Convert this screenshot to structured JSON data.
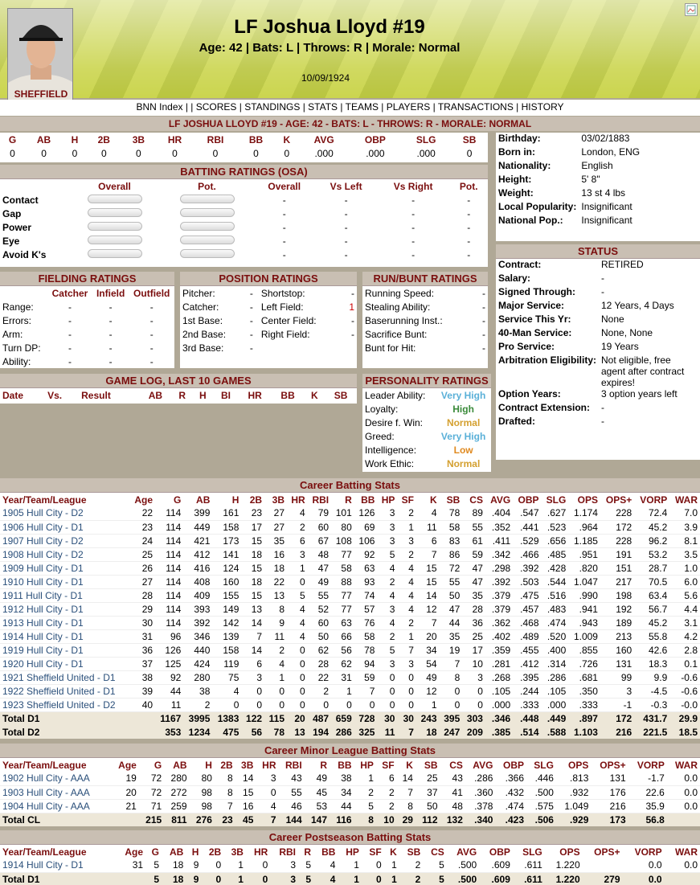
{
  "player": {
    "name": "LF Joshua Lloyd #19",
    "subtitle": "Age: 42 | Bats: L | Throws: R | Morale: Normal",
    "date": "10/09/1924",
    "banner": "LF JOSHUA LLOYD #19 - AGE: 42 - BATS: L - THROWS: R - MORALE: NORMAL",
    "jersey": "SHEFFIELD"
  },
  "nav": [
    "BNN Index",
    " | ",
    "| SCORES",
    " | ",
    "STANDINGS",
    " | ",
    "STATS",
    " | ",
    "TEAMS",
    " | ",
    "PLAYERS",
    " | ",
    "TRANSACTIONS",
    " | ",
    "HISTORY"
  ],
  "summary": {
    "headers": [
      "G",
      "AB",
      "H",
      "2B",
      "3B",
      "HR",
      "RBI",
      "BB",
      "K",
      "AVG",
      "OBP",
      "SLG",
      "SB"
    ],
    "values": [
      "0",
      "0",
      "0",
      "0",
      "0",
      "0",
      "0",
      "0",
      "0",
      ".000",
      ".000",
      ".000",
      "0"
    ]
  },
  "bio": [
    [
      "Birthday:",
      "03/02/1883"
    ],
    [
      "Born in:",
      "London, ENG"
    ],
    [
      "Nationality:",
      "English"
    ],
    [
      "Height:",
      "5' 8\""
    ],
    [
      "Weight:",
      "13 st 4 lbs"
    ],
    [
      "Local Popularity:",
      "Insignificant"
    ],
    [
      "National Pop.:",
      "Insignificant"
    ]
  ],
  "batting_ratings": {
    "title": "BATTING RATINGS (OSA)",
    "headers": [
      "Overall",
      "Pot.",
      "Overall",
      "Vs Left",
      "Vs Right",
      "Pot."
    ],
    "rows": [
      [
        "Contact",
        "-",
        "-",
        "-",
        "-"
      ],
      [
        "Gap",
        "-",
        "-",
        "-",
        "-"
      ],
      [
        "Power",
        "-",
        "-",
        "-",
        "-"
      ],
      [
        "Eye",
        "-",
        "-",
        "-",
        "-"
      ],
      [
        "Avoid K's",
        "-",
        "-",
        "-",
        "-"
      ]
    ]
  },
  "status": {
    "title": "STATUS",
    "rows": [
      [
        "Contract:",
        "RETIRED"
      ],
      [
        "Salary:",
        "-"
      ],
      [
        "Signed Through:",
        "-"
      ],
      [
        "Major Service:",
        "12 Years, 4 Days"
      ],
      [
        "Service This Yr:",
        "None"
      ],
      [
        "40-Man Service:",
        "None, None"
      ],
      [
        "Pro Service:",
        "19 Years"
      ],
      [
        "Arbitration Eligibility:",
        "Not eligible, free agent after contract expires!"
      ],
      [
        "Option Years:",
        "3 option years left"
      ],
      [
        "Contract Extension:",
        "-"
      ],
      [
        "Drafted:",
        "-"
      ]
    ]
  },
  "fielding": {
    "title": "FIELDING RATINGS",
    "headers": [
      "Catcher",
      "Infield",
      "Outfield"
    ],
    "rows": [
      [
        "Range:",
        "-",
        "-",
        "-"
      ],
      [
        "Errors:",
        "-",
        "-",
        "-"
      ],
      [
        "Arm:",
        "-",
        "-",
        "-"
      ],
      [
        "Turn DP:",
        "-",
        "-",
        "-"
      ],
      [
        "Ability:",
        "-",
        "-",
        "-"
      ]
    ]
  },
  "position": {
    "title": "POSITION RATINGS",
    "rows": [
      [
        "Pitcher:",
        "-",
        "Shortstop:",
        "-"
      ],
      [
        "Catcher:",
        "-",
        "Left Field:",
        "1"
      ],
      [
        "1st Base:",
        "-",
        "Center Field:",
        "-"
      ],
      [
        "2nd Base:",
        "-",
        "Right Field:",
        "-"
      ],
      [
        "3rd Base:",
        "-",
        "",
        ""
      ]
    ]
  },
  "runbunt": {
    "title": "RUN/BUNT RATINGS",
    "rows": [
      [
        "Running Speed:",
        "-"
      ],
      [
        "Stealing Ability:",
        "-"
      ],
      [
        "Baserunning Inst.:",
        "-"
      ],
      [
        "Sacrifice Bunt:",
        "-"
      ],
      [
        "Bunt for Hit:",
        "-"
      ]
    ]
  },
  "gamelog": {
    "title": "GAME LOG, LAST 10 GAMES",
    "headers": [
      "Date",
      "Vs.",
      "Result",
      "AB",
      "R",
      "H",
      "BI",
      "HR",
      "BB",
      "K",
      "SB"
    ]
  },
  "personality": {
    "title": "PERSONALITY RATINGS",
    "rows": [
      [
        "Leader Ability:",
        "Very High",
        "vh"
      ],
      [
        "Loyalty:",
        "High",
        "hi"
      ],
      [
        "Desire f. Win:",
        "Normal",
        "no"
      ],
      [
        "Greed:",
        "Very High",
        "vh"
      ],
      [
        "Intelligence:",
        "Low",
        "lo"
      ],
      [
        "Work Ethic:",
        "Normal",
        "no"
      ]
    ]
  },
  "career": {
    "title": "Career Batting Stats",
    "headers": [
      "Year/Team/League",
      "Age",
      "G",
      "AB",
      "H",
      "2B",
      "3B",
      "HR",
      "RBI",
      "R",
      "BB",
      "HP",
      "SF",
      "K",
      "SB",
      "CS",
      "AVG",
      "OBP",
      "SLG",
      "OPS",
      "OPS+",
      "VORP",
      "WAR"
    ],
    "rows": [
      [
        "1905 Hull City - D2",
        "22",
        "114",
        "399",
        "161",
        "23",
        "27",
        "4",
        "79",
        "101",
        "126",
        "3",
        "2",
        "4",
        "78",
        "89",
        ".404",
        ".547",
        ".627",
        "1.174",
        "228",
        "72.4",
        "7.0"
      ],
      [
        "1906 Hull City - D1",
        "23",
        "114",
        "449",
        "158",
        "17",
        "27",
        "2",
        "60",
        "80",
        "69",
        "3",
        "1",
        "11",
        "58",
        "55",
        ".352",
        ".441",
        ".523",
        ".964",
        "172",
        "45.2",
        "3.9"
      ],
      [
        "1907 Hull City - D2",
        "24",
        "114",
        "421",
        "173",
        "15",
        "35",
        "6",
        "67",
        "108",
        "106",
        "3",
        "3",
        "6",
        "83",
        "61",
        ".411",
        ".529",
        ".656",
        "1.185",
        "228",
        "96.2",
        "8.1"
      ],
      [
        "1908 Hull City - D2",
        "25",
        "114",
        "412",
        "141",
        "18",
        "16",
        "3",
        "48",
        "77",
        "92",
        "5",
        "2",
        "7",
        "86",
        "59",
        ".342",
        ".466",
        ".485",
        ".951",
        "191",
        "53.2",
        "3.5"
      ],
      [
        "1909 Hull City - D1",
        "26",
        "114",
        "416",
        "124",
        "15",
        "18",
        "1",
        "47",
        "58",
        "63",
        "4",
        "4",
        "15",
        "72",
        "47",
        ".298",
        ".392",
        ".428",
        ".820",
        "151",
        "28.7",
        "1.0"
      ],
      [
        "1910 Hull City - D1",
        "27",
        "114",
        "408",
        "160",
        "18",
        "22",
        "0",
        "49",
        "88",
        "93",
        "2",
        "4",
        "15",
        "55",
        "47",
        ".392",
        ".503",
        ".544",
        "1.047",
        "217",
        "70.5",
        "6.0"
      ],
      [
        "1911 Hull City - D1",
        "28",
        "114",
        "409",
        "155",
        "15",
        "13",
        "5",
        "55",
        "77",
        "74",
        "4",
        "4",
        "14",
        "50",
        "35",
        ".379",
        ".475",
        ".516",
        ".990",
        "198",
        "63.4",
        "5.6"
      ],
      [
        "1912 Hull City - D1",
        "29",
        "114",
        "393",
        "149",
        "13",
        "8",
        "4",
        "52",
        "77",
        "57",
        "3",
        "4",
        "12",
        "47",
        "28",
        ".379",
        ".457",
        ".483",
        ".941",
        "192",
        "56.7",
        "4.4"
      ],
      [
        "1913 Hull City - D1",
        "30",
        "114",
        "392",
        "142",
        "14",
        "9",
        "4",
        "60",
        "63",
        "76",
        "4",
        "2",
        "7",
        "44",
        "36",
        ".362",
        ".468",
        ".474",
        ".943",
        "189",
        "45.2",
        "3.1"
      ],
      [
        "1914 Hull City - D1",
        "31",
        "96",
        "346",
        "139",
        "7",
        "11",
        "4",
        "50",
        "66",
        "58",
        "2",
        "1",
        "20",
        "35",
        "25",
        ".402",
        ".489",
        ".520",
        "1.009",
        "213",
        "55.8",
        "4.2"
      ],
      [
        "1919 Hull City - D1",
        "36",
        "126",
        "440",
        "158",
        "14",
        "2",
        "0",
        "62",
        "56",
        "78",
        "5",
        "7",
        "34",
        "19",
        "17",
        ".359",
        ".455",
        ".400",
        ".855",
        "160",
        "42.6",
        "2.8"
      ],
      [
        "1920 Hull City - D1",
        "37",
        "125",
        "424",
        "119",
        "6",
        "4",
        "0",
        "28",
        "62",
        "94",
        "3",
        "3",
        "54",
        "7",
        "10",
        ".281",
        ".412",
        ".314",
        ".726",
        "131",
        "18.3",
        "0.1"
      ],
      [
        "1921 Sheffield United - D1",
        "38",
        "92",
        "280",
        "75",
        "3",
        "1",
        "0",
        "22",
        "31",
        "59",
        "0",
        "0",
        "49",
        "8",
        "3",
        ".268",
        ".395",
        ".286",
        ".681",
        "99",
        "9.9",
        "-0.6"
      ],
      [
        "1922 Sheffield United - D1",
        "39",
        "44",
        "38",
        "4",
        "0",
        "0",
        "0",
        "2",
        "1",
        "7",
        "0",
        "0",
        "12",
        "0",
        "0",
        ".105",
        ".244",
        ".105",
        ".350",
        "3",
        "-4.5",
        "-0.6"
      ],
      [
        "1923 Sheffield United - D2",
        "40",
        "11",
        "2",
        "0",
        "0",
        "0",
        "0",
        "0",
        "0",
        "0",
        "0",
        "0",
        "1",
        "0",
        "0",
        ".000",
        ".333",
        ".000",
        ".333",
        "-1",
        "-0.3",
        "-0.0"
      ]
    ],
    "totals": [
      [
        "Total D1",
        "",
        "1167",
        "3995",
        "1383",
        "122",
        "115",
        "20",
        "487",
        "659",
        "728",
        "30",
        "30",
        "243",
        "395",
        "303",
        ".346",
        ".448",
        ".449",
        ".897",
        "172",
        "431.7",
        "29.9"
      ],
      [
        "Total D2",
        "",
        "353",
        "1234",
        "475",
        "56",
        "78",
        "13",
        "194",
        "286",
        "325",
        "11",
        "7",
        "18",
        "247",
        "209",
        ".385",
        ".514",
        ".588",
        "1.103",
        "216",
        "221.5",
        "18.5"
      ]
    ]
  },
  "minor": {
    "title": "Career Minor League Batting Stats",
    "headers": [
      "Year/Team/League",
      "Age",
      "G",
      "AB",
      "H",
      "2B",
      "3B",
      "HR",
      "RBI",
      "R",
      "BB",
      "HP",
      "SF",
      "K",
      "SB",
      "CS",
      "AVG",
      "OBP",
      "SLG",
      "OPS",
      "OPS+",
      "VORP",
      "WAR"
    ],
    "rows": [
      [
        "1902 Hull City - AAA",
        "19",
        "72",
        "280",
        "80",
        "8",
        "14",
        "3",
        "43",
        "49",
        "38",
        "1",
        "6",
        "14",
        "25",
        "43",
        ".286",
        ".366",
        ".446",
        ".813",
        "131",
        "-1.7",
        "0.0"
      ],
      [
        "1903 Hull City - AAA",
        "20",
        "72",
        "272",
        "98",
        "8",
        "15",
        "0",
        "55",
        "45",
        "34",
        "2",
        "2",
        "7",
        "37",
        "41",
        ".360",
        ".432",
        ".500",
        ".932",
        "176",
        "22.6",
        "0.0"
      ],
      [
        "1904 Hull City - AAA",
        "21",
        "71",
        "259",
        "98",
        "7",
        "16",
        "4",
        "46",
        "53",
        "44",
        "5",
        "2",
        "8",
        "50",
        "48",
        ".378",
        ".474",
        ".575",
        "1.049",
        "216",
        "35.9",
        "0.0"
      ]
    ],
    "totals": [
      [
        "Total CL",
        "",
        "215",
        "811",
        "276",
        "23",
        "45",
        "7",
        "144",
        "147",
        "116",
        "8",
        "10",
        "29",
        "112",
        "132",
        ".340",
        ".423",
        ".506",
        ".929",
        "173",
        "56.8",
        ""
      ]
    ]
  },
  "post": {
    "title": "Career Postseason Batting Stats",
    "headers": [
      "Year/Team/League",
      "Age",
      "G",
      "AB",
      "H",
      "2B",
      "3B",
      "HR",
      "RBI",
      "R",
      "BB",
      "HP",
      "SF",
      "K",
      "SB",
      "CS",
      "AVG",
      "OBP",
      "SLG",
      "OPS",
      "OPS+",
      "VORP",
      "WAR"
    ],
    "rows": [
      [
        "1914 Hull City - D1",
        "31",
        "5",
        "18",
        "9",
        "0",
        "1",
        "0",
        "3",
        "5",
        "4",
        "1",
        "0",
        "1",
        "2",
        "5",
        ".500",
        ".609",
        ".611",
        "1.220",
        "",
        "0.0",
        "0.0"
      ]
    ],
    "totals": [
      [
        "Total D1",
        "",
        "5",
        "18",
        "9",
        "0",
        "1",
        "0",
        "3",
        "5",
        "4",
        "1",
        "0",
        "1",
        "2",
        "5",
        ".500",
        ".609",
        ".611",
        "1.220",
        "279",
        "0.0",
        ""
      ]
    ]
  }
}
